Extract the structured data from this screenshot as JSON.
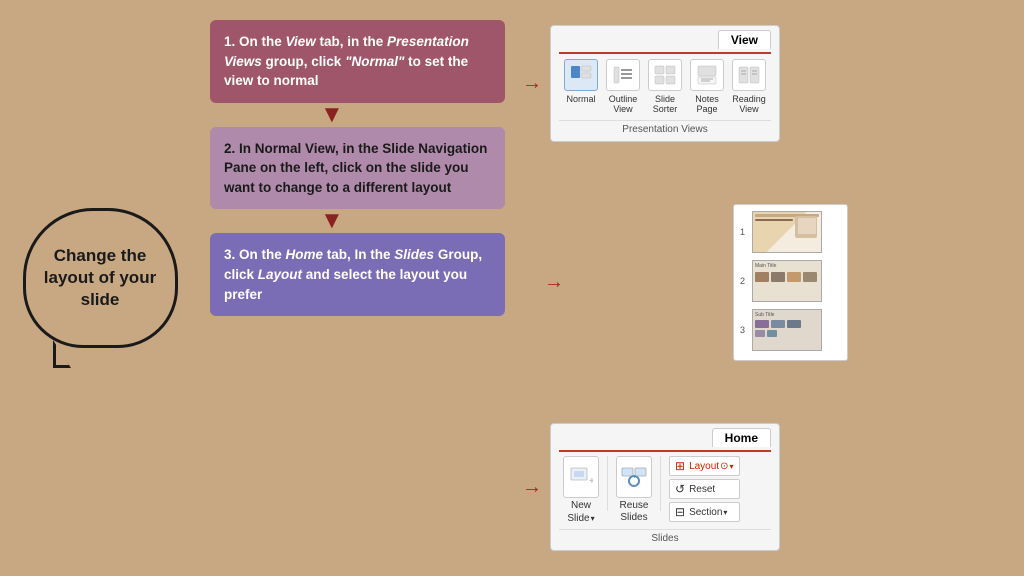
{
  "left_panel": {
    "speech_bubble_text": "Change the layout of your slide"
  },
  "steps": {
    "step1": {
      "text": "1. On the View tab, in the Presentation Views group, click \"Normal\"  to set the view to normal"
    },
    "step2": {
      "text": "2. In Normal View, in the Slide Navigation Pane on the left, click on the slide you want to change to a different layout"
    },
    "step3": {
      "text": "3. On the Home tab, In the Slides Group, click Layout and select the layout you prefer"
    }
  },
  "ribbon_view": {
    "tab_label": "View",
    "group_label": "Presentation Views",
    "buttons": [
      {
        "label": "Normal",
        "active": true
      },
      {
        "label": "Outline View"
      },
      {
        "label": "Slide Sorter"
      },
      {
        "label": "Notes Page"
      },
      {
        "label": "Reading View"
      }
    ]
  },
  "ribbon_home": {
    "tab_label": "Home",
    "group_label": "Slides",
    "buttons": [
      {
        "label": "New Slide ↓"
      },
      {
        "label": "Reuse Slides"
      },
      {
        "label": "Layout ⊙",
        "active": true
      },
      {
        "label": "Reset"
      },
      {
        "label": "⊟ Section ↓"
      }
    ]
  },
  "slide_nav": {
    "slides": [
      {
        "number": "1"
      },
      {
        "number": "2"
      },
      {
        "number": "3"
      }
    ]
  }
}
